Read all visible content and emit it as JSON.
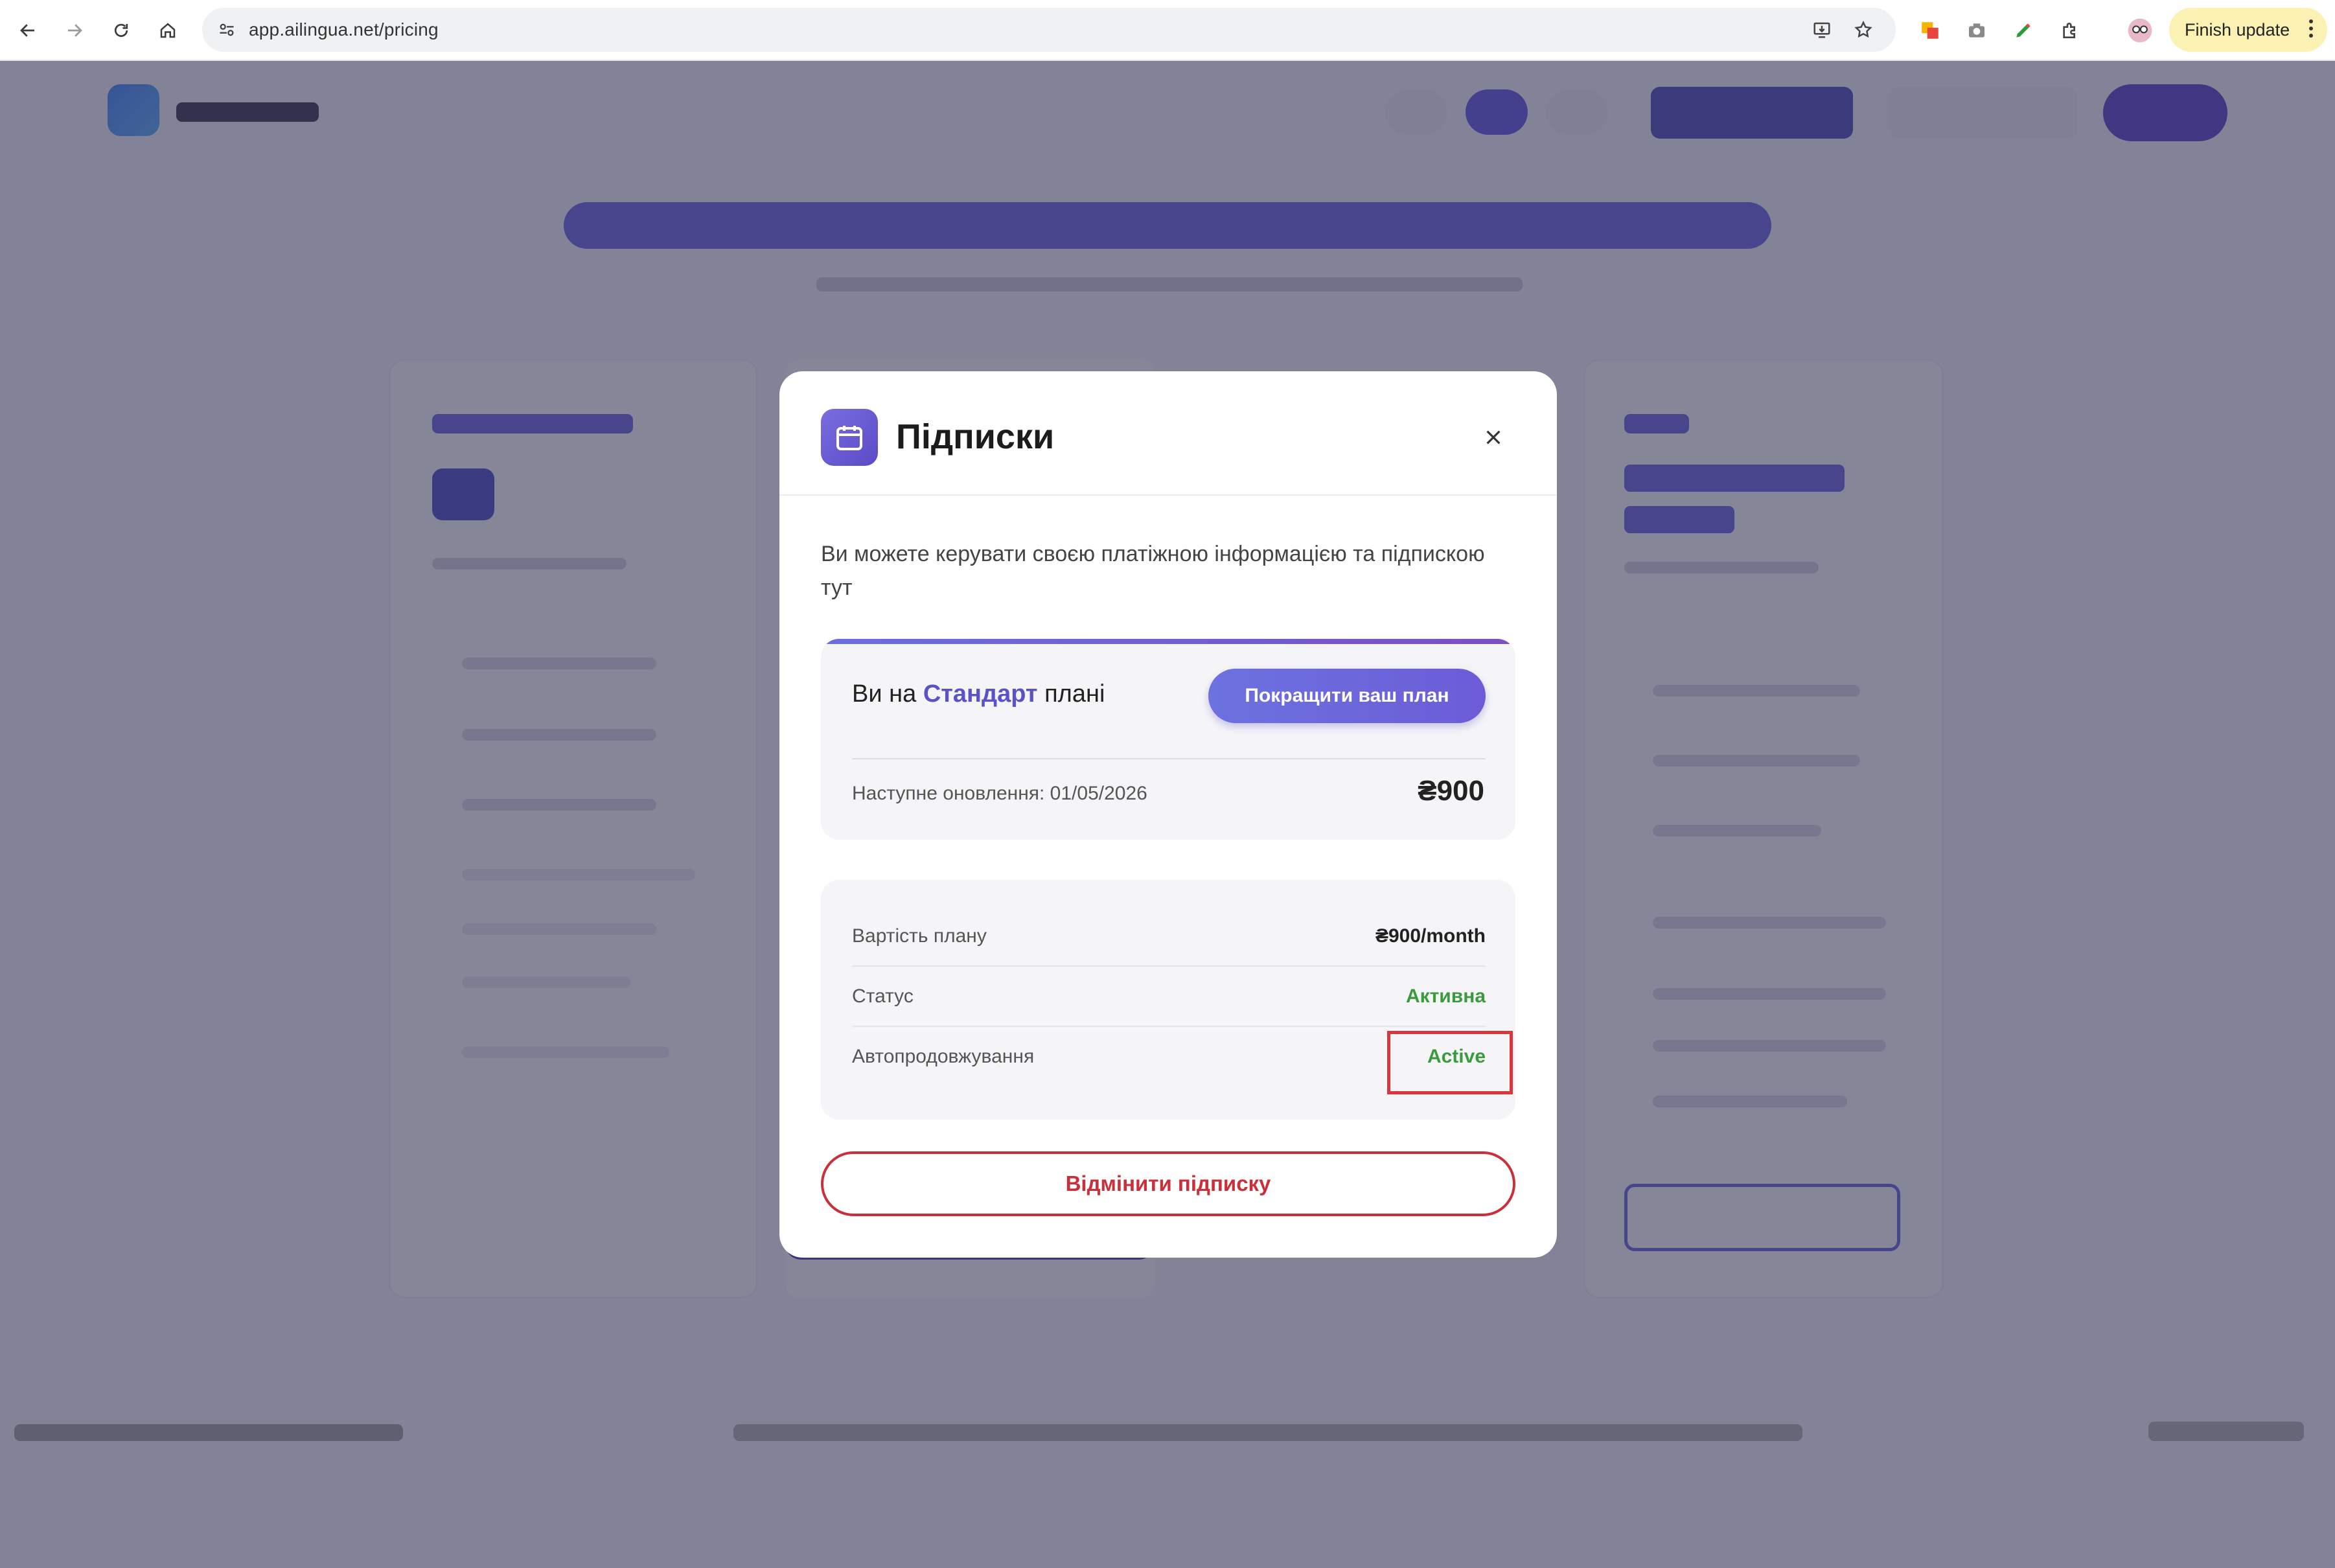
{
  "browser": {
    "url": "app.ailingua.net/pricing",
    "finish_update_label": "Finish update"
  },
  "modal": {
    "title": "Підписки",
    "description": "Ви можете керувати своєю платіжною інформацією та підпискою тут",
    "plan": {
      "prefix": "Ви на",
      "name": "Стандарт",
      "suffix": "плані",
      "upgrade_label": "Покращити ваш план",
      "renewal_text": "Наступне оновлення: 01/05/2026",
      "price": "₴900"
    },
    "details": [
      {
        "label": "Вартість плану",
        "value": "₴900/month",
        "color": "#222222"
      },
      {
        "label": "Статус",
        "value": "Активна",
        "color": "#3a9a3e"
      },
      {
        "label": "Автопродовжування",
        "value": "Active",
        "color": "#3a9a3e"
      }
    ],
    "cancel_label": "Відмінити підписку"
  },
  "colors": {
    "accent": "#5a52c8",
    "danger": "#c9303a",
    "success": "#3a9a3e",
    "highlight": "#d9363e"
  }
}
